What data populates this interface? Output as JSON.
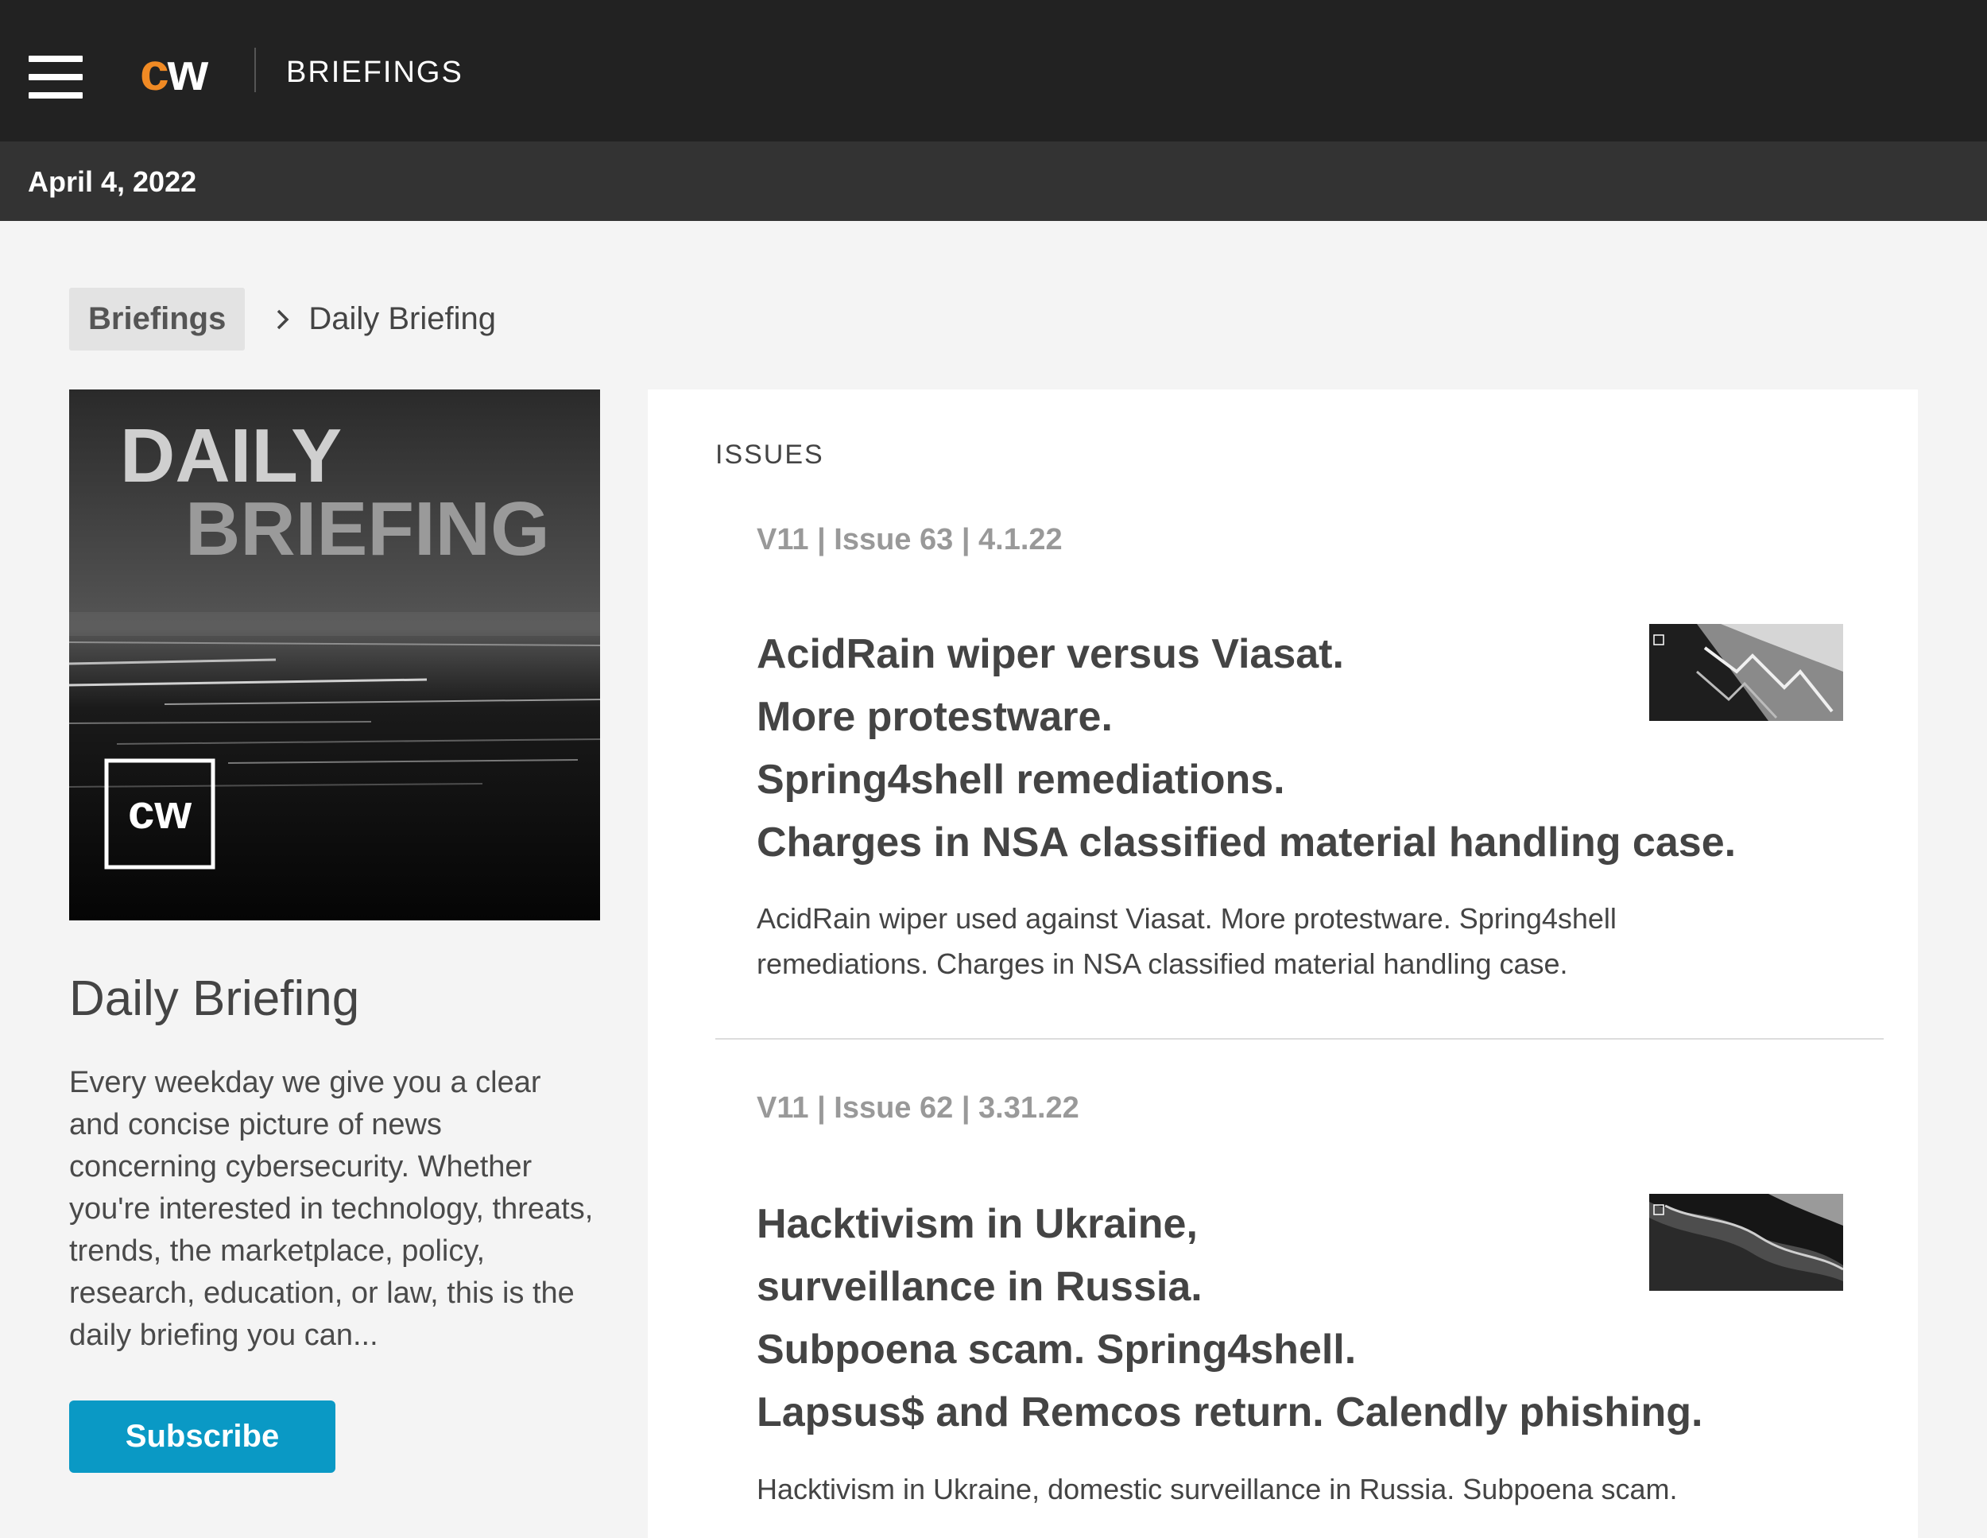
{
  "header": {
    "logo_c": "c",
    "logo_w": "w",
    "section_title": "BRIEFINGS"
  },
  "datebar": {
    "date": "April 4, 2022"
  },
  "breadcrumb": {
    "home": "Briefings",
    "current": "Daily Briefing"
  },
  "cover": {
    "line1": "DAILY",
    "line2": "BRIEFING",
    "badge": "cw"
  },
  "sidebar": {
    "title": "Daily Briefing",
    "description": "Every weekday we give you a clear and concise picture of news concerning cybersecurity. Whether you're interested in technology, threats, trends, the marketplace, policy, research, education, or law, this is the daily briefing you can...",
    "subscribe_label": "Subscribe"
  },
  "issues": {
    "heading": "ISSUES",
    "items": [
      {
        "meta": "V11 | Issue 63 | 4.1.22",
        "headline": [
          "AcidRain wiper versus Viasat.",
          "More protestware.",
          "Spring4shell remediations.",
          "Charges in NSA classified material handling case."
        ],
        "summary": "AcidRain wiper used against Viasat. More protestware. Spring4shell remediations. Charges in NSA classified material handling case."
      },
      {
        "meta": "V11 | Issue 62 | 3.31.22",
        "headline": [
          "Hacktivism in Ukraine,",
          "surveillance in Russia.",
          "Subpoena scam. Spring4shell.",
          "Lapsus$ and Remcos return. Calendly phishing."
        ],
        "summary": "Hacktivism in Ukraine, domestic surveillance in Russia. Subpoena scam."
      }
    ]
  },
  "colors": {
    "topbar": "#222222",
    "datebar": "#333333",
    "logo_accent": "#f08a24",
    "subscribe": "#0a99c5",
    "meta_gray": "#999999"
  }
}
